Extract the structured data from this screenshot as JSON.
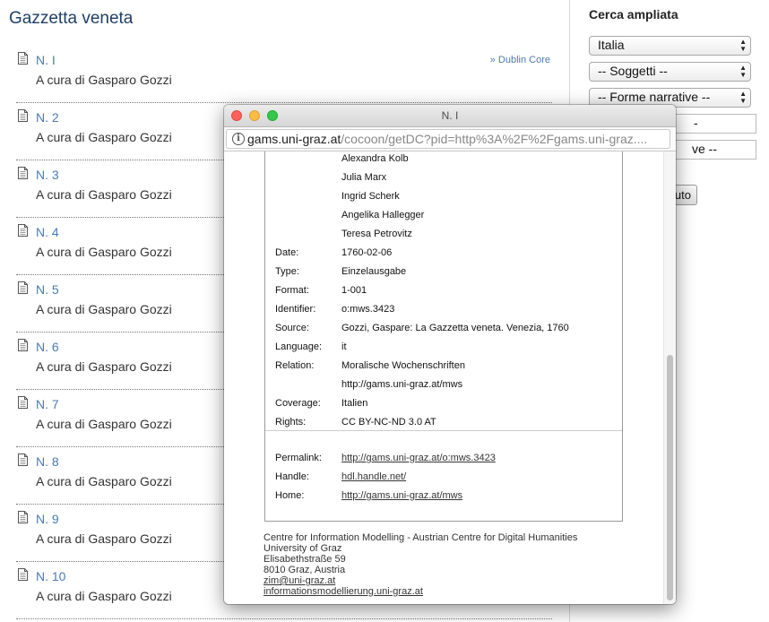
{
  "page": {
    "title": "Gazzetta veneta"
  },
  "issues": [
    {
      "label": "N. I",
      "subtitle": "A cura di Gasparo Gozzi",
      "dc_link": "» Dublin Core"
    },
    {
      "label": "N. 2",
      "subtitle": "A cura di Gasparo Gozzi"
    },
    {
      "label": "N. 3",
      "subtitle": "A cura di Gasparo Gozzi"
    },
    {
      "label": "N. 4",
      "subtitle": "A cura di Gasparo Gozzi"
    },
    {
      "label": "N. 5",
      "subtitle": "A cura di Gasparo Gozzi"
    },
    {
      "label": "N. 6",
      "subtitle": "A cura di Gasparo Gozzi"
    },
    {
      "label": "N. 7",
      "subtitle": "A cura di Gasparo Gozzi"
    },
    {
      "label": "N. 8",
      "subtitle": "A cura di Gasparo Gozzi"
    },
    {
      "label": "N. 9",
      "subtitle": "A cura di Gasparo Gozzi"
    },
    {
      "label": "N. 10",
      "subtitle": "A cura di Gasparo Gozzi"
    }
  ],
  "sidebar": {
    "title": "Cerca ampliata",
    "select_country": "Italia",
    "select_subjects": "-- Soggetti --",
    "select_narrative": "-- Forme narrative --",
    "input_1_value": "-",
    "input_2_value": "ve --",
    "button_label": "uto"
  },
  "popup": {
    "window_title": "N. I",
    "url_host": "gams.uni-graz.at",
    "url_path": "/cocoon/getDC?pid=http%3A%2F%2Fgams.uni-graz....",
    "contributors": [
      "Alexandra Kolb",
      "Julia Marx",
      "Ingrid Scherk",
      "Angelika Hallegger",
      "Teresa Petrovitz"
    ],
    "fields": {
      "date": {
        "label": "Date:",
        "value": "1760-02-06"
      },
      "type": {
        "label": "Type:",
        "value": "Einzelausgabe"
      },
      "format": {
        "label": "Format:",
        "value": "1-001"
      },
      "identifier": {
        "label": "Identifier:",
        "value": "o:mws.3423"
      },
      "source": {
        "label": "Source:",
        "value": "Gozzi, Gaspare: La Gazzetta veneta. Venezia, 1760"
      },
      "language": {
        "label": "Language:",
        "value": "it"
      },
      "relation": {
        "label": "Relation:",
        "value": "Moralische Wochenschriften",
        "value2": "http://gams.uni-graz.at/mws"
      },
      "coverage": {
        "label": "Coverage:",
        "value": "Italien"
      },
      "rights": {
        "label": "Rights:",
        "value": "CC BY-NC-ND 3.0 AT"
      }
    },
    "links": {
      "permalink": {
        "label": "Permalink:",
        "value": "http://gams.uni-graz.at/o:mws.3423"
      },
      "handle": {
        "label": "Handle:",
        "value": "hdl.handle.net/"
      },
      "home": {
        "label": "Home:",
        "value": "http://gams.uni-graz.at/mws"
      }
    },
    "footer": {
      "line1": "Centre for Information Modelling - Austrian Centre for Digital Humanities",
      "line2": "University of Graz",
      "line3": "Elisabethstraße 59",
      "line4": "8010 Graz, Austria",
      "email": "zim@uni-graz.at",
      "website": "informationsmodellierung.uni-graz.at"
    }
  },
  "icons": {
    "issue_icon": "document-icon",
    "info_icon": "info-icon"
  }
}
